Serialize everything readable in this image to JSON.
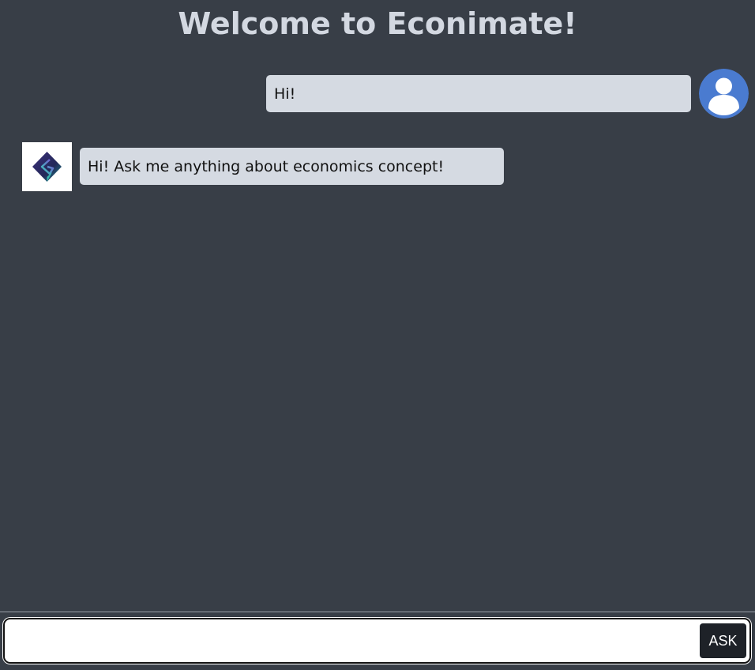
{
  "header": {
    "title": "Welcome to Econimate!"
  },
  "messages": [
    {
      "role": "user",
      "text": "Hi!",
      "avatar_icon": "user-silhouette-icon"
    },
    {
      "role": "bot",
      "text": "Hi! Ask me anything about economics concept!",
      "avatar_icon": "econimate-logo-icon"
    }
  ],
  "composer": {
    "input_value": "",
    "input_placeholder": "",
    "ask_label": "ASK"
  },
  "colors": {
    "background": "#383e47",
    "title": "#d3d8e1",
    "bubble": "#d5dae2",
    "user_avatar": "#4a7bd0",
    "button": "#1e2228"
  }
}
